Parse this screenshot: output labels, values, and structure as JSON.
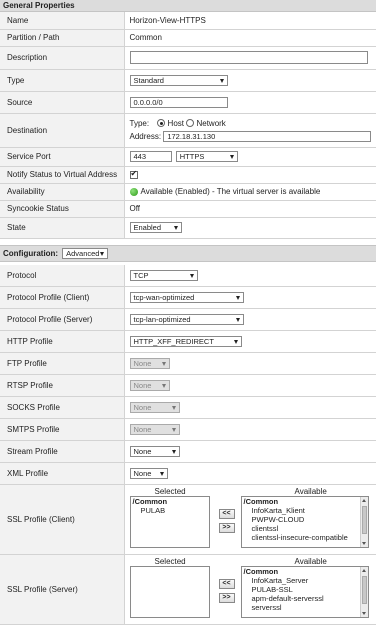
{
  "general": {
    "title": "General Properties",
    "name_label": "Name",
    "name_value": "Horizon-View-HTTPS",
    "partition_label": "Partition / Path",
    "partition_value": "Common",
    "description_label": "Description",
    "description_value": "",
    "type_label": "Type",
    "type_value": "Standard",
    "source_label": "Source",
    "source_value": "0.0.0.0/0",
    "destination_label": "Destination",
    "dest_type_label": "Type:",
    "dest_host_label": "Host",
    "dest_network_label": "Network",
    "dest_host_selected": true,
    "dest_address_label": "Address:",
    "dest_address_value": "172.18.31.130",
    "service_port_label": "Service Port",
    "service_port_value": "443",
    "service_port_proto": "HTTPS",
    "notify_label": "Notify Status to Virtual Address",
    "notify_checked": true,
    "availability_label": "Availability",
    "availability_value": "Available (Enabled) - The virtual server is available",
    "syncookie_label": "Syncookie Status",
    "syncookie_value": "Off",
    "state_label": "State",
    "state_value": "Enabled"
  },
  "config": {
    "label": "Configuration:",
    "mode": "Advanced",
    "protocol_label": "Protocol",
    "protocol_value": "TCP",
    "pp_client_label": "Protocol Profile (Client)",
    "pp_client_value": "tcp-wan-optimized",
    "pp_server_label": "Protocol Profile (Server)",
    "pp_server_value": "tcp-lan-optimized",
    "http_label": "HTTP Profile",
    "http_value": "HTTP_XFF_REDIRECT",
    "ftp_label": "FTP Profile",
    "ftp_value": "None",
    "rtsp_label": "RTSP Profile",
    "rtsp_value": "None",
    "socks_label": "SOCKS Profile",
    "socks_value": "None",
    "smtps_label": "SMTPS Profile",
    "smtps_value": "None",
    "stream_label": "Stream Profile",
    "stream_value": "None",
    "xml_label": "XML Profile",
    "xml_value": "None",
    "selected_header": "Selected",
    "available_header": "Available",
    "move_left": "<<",
    "move_right": ">>",
    "ssl_client": {
      "label": "SSL Profile (Client)",
      "selected_group": "/Common",
      "selected": [
        "PULAB"
      ],
      "available_group": "/Common",
      "available": [
        "InfoKarta_Klient",
        "PWPW-CLOUD",
        "clientssl",
        "clientssl-insecure-compatible"
      ]
    },
    "ssl_server": {
      "label": "SSL Profile (Server)",
      "selected_group": "",
      "selected": [],
      "available_group": "/Common",
      "available": [
        "InfoKarta_Server",
        "PULAB-SSL",
        "apm-default-serverssl",
        "serverssl"
      ]
    }
  }
}
